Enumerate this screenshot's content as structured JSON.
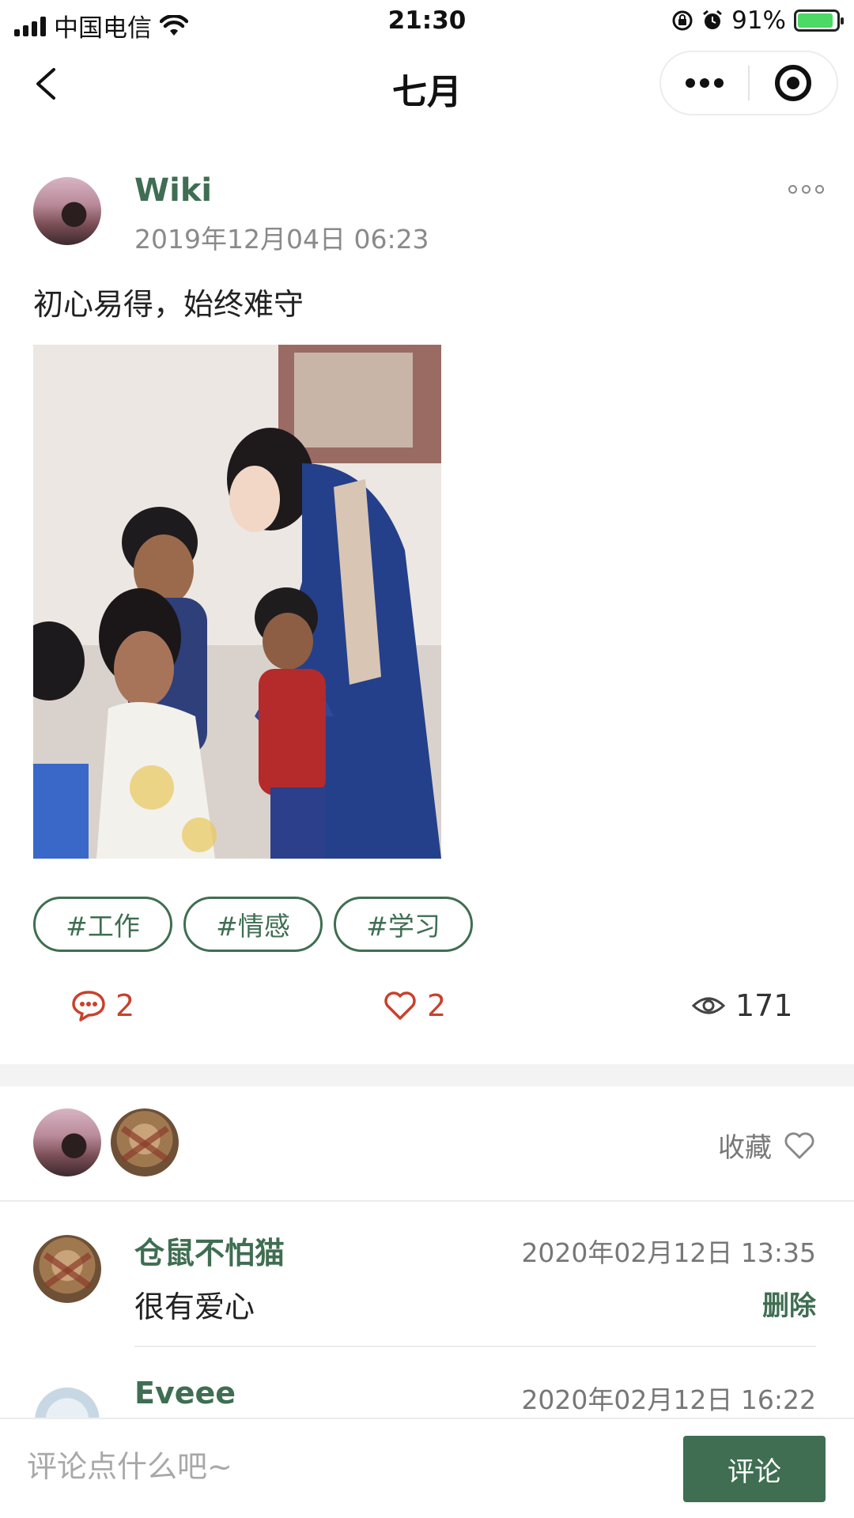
{
  "status_bar": {
    "carrier": "中国电信",
    "time": "21:30",
    "battery_percent": "91%",
    "battery_level": 0.91
  },
  "nav": {
    "title": "七月"
  },
  "post": {
    "author": "Wiki",
    "datetime": "2019年12月04日 06:23",
    "text": "初心易得，始终难守",
    "tags": [
      "#工作",
      "#情感",
      "#学习"
    ],
    "stats": {
      "comments": "2",
      "likes": "2",
      "views": "171"
    }
  },
  "likers": {
    "favorite_label": "收藏"
  },
  "comments": [
    {
      "name": "仓鼠不怕猫",
      "datetime": "2020年02月12日 13:35",
      "text": "很有爱心",
      "delete_label": "删除"
    },
    {
      "name": "Eveee",
      "datetime": "2020年02月12日 16:22"
    }
  ],
  "bottom": {
    "placeholder": "评论点什么吧~",
    "submit_label": "评论"
  },
  "colors": {
    "accent_green": "#3f6e52",
    "accent_red": "#c9412c"
  }
}
